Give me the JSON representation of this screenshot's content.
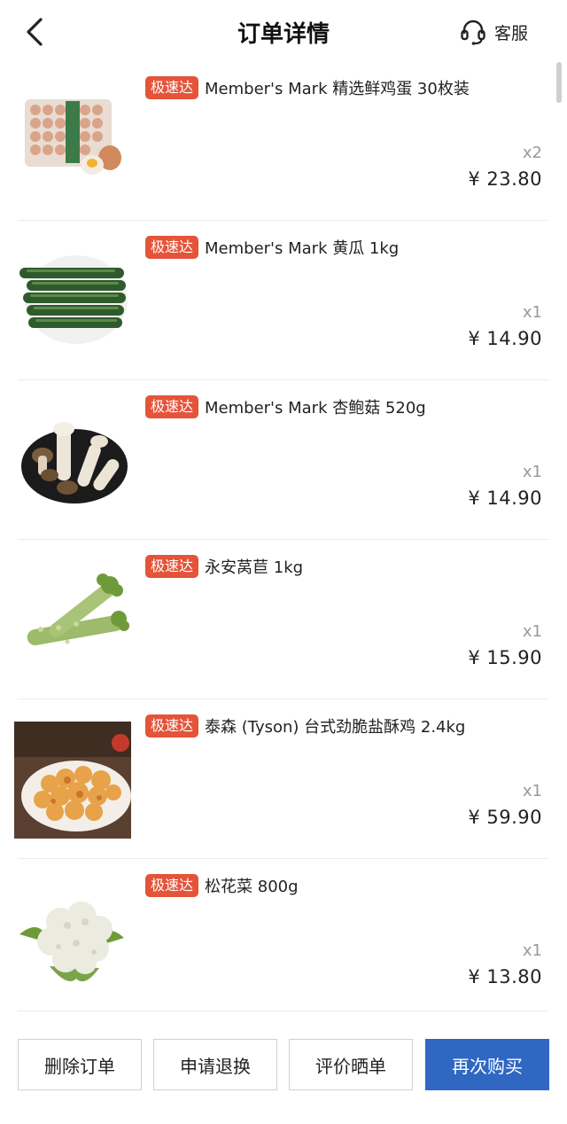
{
  "header": {
    "title": "订单详情",
    "service_label": "客服",
    "back_icon": "chevron-left-icon",
    "service_icon": "headset-icon"
  },
  "items": [
    {
      "tag": "极速达",
      "name": "Member's Mark 精选鲜鸡蛋 30枚装",
      "qty": "x2",
      "price": "¥ 23.80",
      "image": "egg-carton"
    },
    {
      "tag": "极速达",
      "name": "Member's Mark 黄瓜 1kg",
      "qty": "x1",
      "price": "¥ 14.90",
      "image": "cucumbers"
    },
    {
      "tag": "极速达",
      "name": "Member's Mark 杏鲍菇 520g",
      "qty": "x1",
      "price": "¥ 14.90",
      "image": "king-oyster-mushrooms"
    },
    {
      "tag": "极速达",
      "name": "永安莴苣 1kg",
      "qty": "x1",
      "price": "¥ 15.90",
      "image": "celtuce"
    },
    {
      "tag": "极速达",
      "name": "泰森 (Tyson) 台式劲脆盐酥鸡 2.4kg",
      "qty": "x1",
      "price": "¥ 59.90",
      "image": "popcorn-chicken"
    },
    {
      "tag": "极速达",
      "name": "松花菜 800g",
      "qty": "x1",
      "price": "¥ 13.80",
      "image": "cauliflower"
    }
  ],
  "footer": {
    "delete_label": "删除订单",
    "refund_label": "申请退换",
    "review_label": "评价晒单",
    "rebuy_label": "再次购买"
  },
  "colors": {
    "tag": "#e4543a",
    "primary": "#2f67c3"
  }
}
